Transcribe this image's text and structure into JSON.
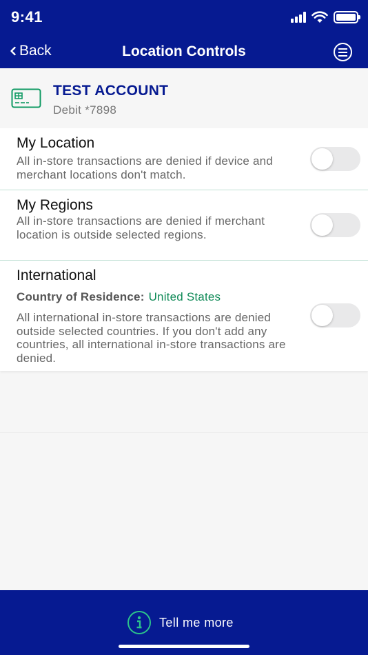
{
  "status_bar": {
    "time": "9:41",
    "icons": [
      "cellular-signal-icon",
      "wifi-icon",
      "battery-icon"
    ]
  },
  "nav": {
    "back_label": "Back",
    "title": "Location Controls",
    "menu_icon": "menu-icon"
  },
  "account": {
    "icon": "card-icon",
    "name": "TEST ACCOUNT",
    "subtitle": "Debit *7898"
  },
  "controls": [
    {
      "title": "My Location",
      "description": "All in-store transactions are denied if device and merchant locations don't match.",
      "enabled": false
    },
    {
      "title": "My Regions",
      "description": "All in-store transactions are denied if merchant location is outside selected regions.",
      "enabled": false
    },
    {
      "title": "International",
      "residence_label": "Country of Residence:",
      "residence_value": "United States",
      "description": "All international in-store transactions are denied outside selected countries. If you don't add any countries, all international in-store transactions are denied.",
      "enabled": false
    }
  ],
  "footer": {
    "tell_more_label": "Tell me more",
    "icon": "info-icon"
  },
  "colors": {
    "brand_navy": "#061a91",
    "accent_green": "#0f8a57",
    "divider": "#bfe0d4",
    "background": "#f6f6f6"
  }
}
